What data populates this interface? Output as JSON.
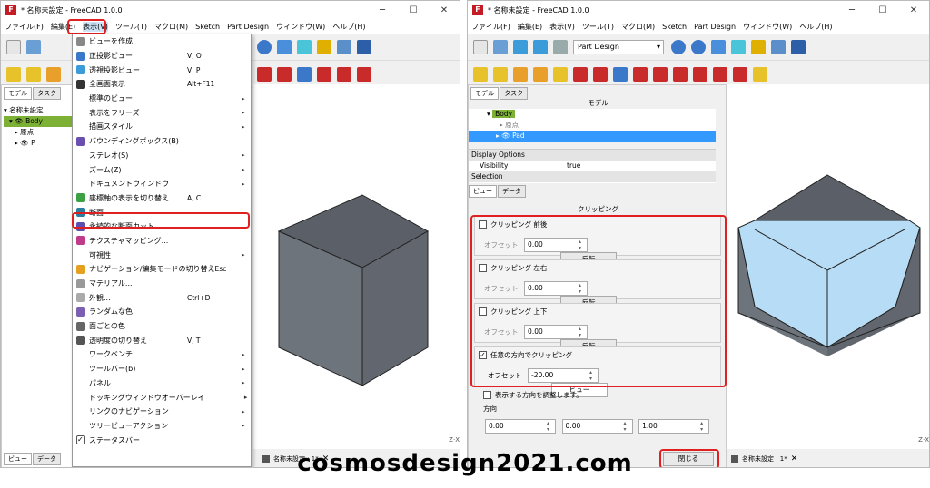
{
  "colors": {
    "red": "#e02020",
    "face_top": "#5b6068",
    "face_left": "#6e747c",
    "face_right": "#62676f",
    "cut": "#b7dcf5",
    "accent": "#7db135",
    "sel": "#3399ff"
  },
  "left": {
    "title": "* 名称未設定 - FreeCAD 1.0.0",
    "menus": [
      "ファイル(F)",
      "編集(E)",
      "表示(V)",
      "ツール(T)",
      "マクロ(M)",
      "Sketch",
      "Part Design",
      "ウィンドウ(W)",
      "ヘルプ(H)"
    ],
    "panel_tabs": [
      "モデル",
      "タスク"
    ],
    "tree": {
      "root": "名称未設定",
      "body": "Body",
      "origin": "原点",
      "pad": "P"
    },
    "bottom_tabs": [
      "ビュー",
      "データ"
    ],
    "doc_tab": "名称未設定 : 1*",
    "menu_items": [
      {
        "label": "ビューを作成",
        "shortcut": "",
        "arrow": ""
      },
      {
        "label": "正投影ビュー",
        "shortcut": "V, O",
        "arrow": ""
      },
      {
        "label": "透視投影ビュー",
        "shortcut": "V, P",
        "arrow": ""
      },
      {
        "label": "全画面表示",
        "shortcut": "Alt+F11",
        "arrow": ""
      },
      {
        "label": "標準のビュー",
        "shortcut": "",
        "arrow": "▸"
      },
      {
        "label": "表示をフリーズ",
        "shortcut": "",
        "arrow": "▸"
      },
      {
        "label": "描画スタイル",
        "shortcut": "",
        "arrow": "▸"
      },
      {
        "label": "バウンディングボックス(B)",
        "shortcut": "",
        "arrow": ""
      },
      {
        "label": "ステレオ(S)",
        "shortcut": "",
        "arrow": "▸"
      },
      {
        "label": "ズーム(Z)",
        "shortcut": "",
        "arrow": "▸"
      },
      {
        "label": "ドキュメントウィンドウ",
        "shortcut": "",
        "arrow": "▸"
      },
      {
        "label": "座標軸の表示を切り替え",
        "shortcut": "A, C",
        "arrow": ""
      },
      {
        "label": "断面",
        "shortcut": "",
        "arrow": ""
      },
      {
        "label": "永続的な断面カット",
        "shortcut": "",
        "arrow": ""
      },
      {
        "label": "テクスチャマッピング...",
        "shortcut": "",
        "arrow": ""
      },
      {
        "label": "可視性",
        "shortcut": "",
        "arrow": "▸"
      },
      {
        "label": "ナビゲーション/編集モードの切り替え",
        "shortcut": "Esc",
        "arrow": ""
      },
      {
        "label": "マテリアル...",
        "shortcut": "",
        "arrow": ""
      },
      {
        "label": "外観...",
        "shortcut": "Ctrl+D",
        "arrow": ""
      },
      {
        "label": "ランダムな色",
        "shortcut": "",
        "arrow": ""
      },
      {
        "label": "面ごとの色",
        "shortcut": "",
        "arrow": ""
      },
      {
        "label": "透明度の切り替え",
        "shortcut": "V, T",
        "arrow": ""
      },
      {
        "label": "ワークベンチ",
        "shortcut": "",
        "arrow": "▸"
      },
      {
        "label": "ツールバー(b)",
        "shortcut": "",
        "arrow": "▸"
      },
      {
        "label": "パネル",
        "shortcut": "",
        "arrow": "▸"
      },
      {
        "label": "ドッキングウィンドウオーバーレイ",
        "shortcut": "",
        "arrow": "▸"
      },
      {
        "label": "リンクのナビゲーション",
        "shortcut": "",
        "arrow": "▸"
      },
      {
        "label": "ツリービューアクション",
        "shortcut": "",
        "arrow": "▸"
      },
      {
        "label": "ステータスバー",
        "shortcut": "",
        "arrow": ""
      }
    ]
  },
  "right": {
    "title": "* 名称未設定 - FreeCAD 1.0.0",
    "menus": [
      "ファイル(F)",
      "編集(E)",
      "表示(V)",
      "ツール(T)",
      "マクロ(M)",
      "Sketch",
      "Part Design",
      "ウィンドウ(W)",
      "ヘルプ(H)"
    ],
    "workbench": "Part Design",
    "panel_tabs": [
      "モデル",
      "タスク"
    ],
    "model_label": "モデル",
    "tree": {
      "body": "Body",
      "origin": "原点",
      "pad": "Pad"
    },
    "props": {
      "group": "Display Options",
      "key": "Visibility",
      "value": "true",
      "group2": "Selection"
    },
    "prop_tabs": [
      "ビュー",
      "データ"
    ],
    "clip": {
      "title": "クリッピング",
      "offset_label": "オフセット",
      "flip_label": "反転",
      "rows": [
        {
          "label": "クリッピング 前後",
          "checked": false,
          "offset": "0.00"
        },
        {
          "label": "クリッピング 左右",
          "checked": false,
          "offset": "0.00"
        },
        {
          "label": "クリッピング 上下",
          "checked": false,
          "offset": "0.00"
        }
      ],
      "custom_label": "任意の方向でクリッピング",
      "custom_checked": true,
      "custom_offset": "-20.00",
      "view_button": "ビュー",
      "adjust_label": "表示する方向を調整します。",
      "direction_label": "方向",
      "dir": [
        "0.00",
        "0.00",
        "1.00"
      ],
      "close": "閉じる"
    },
    "doc_tab": "名称未設定 : 1*"
  },
  "watermark": "cosmosdesign2021.com"
}
